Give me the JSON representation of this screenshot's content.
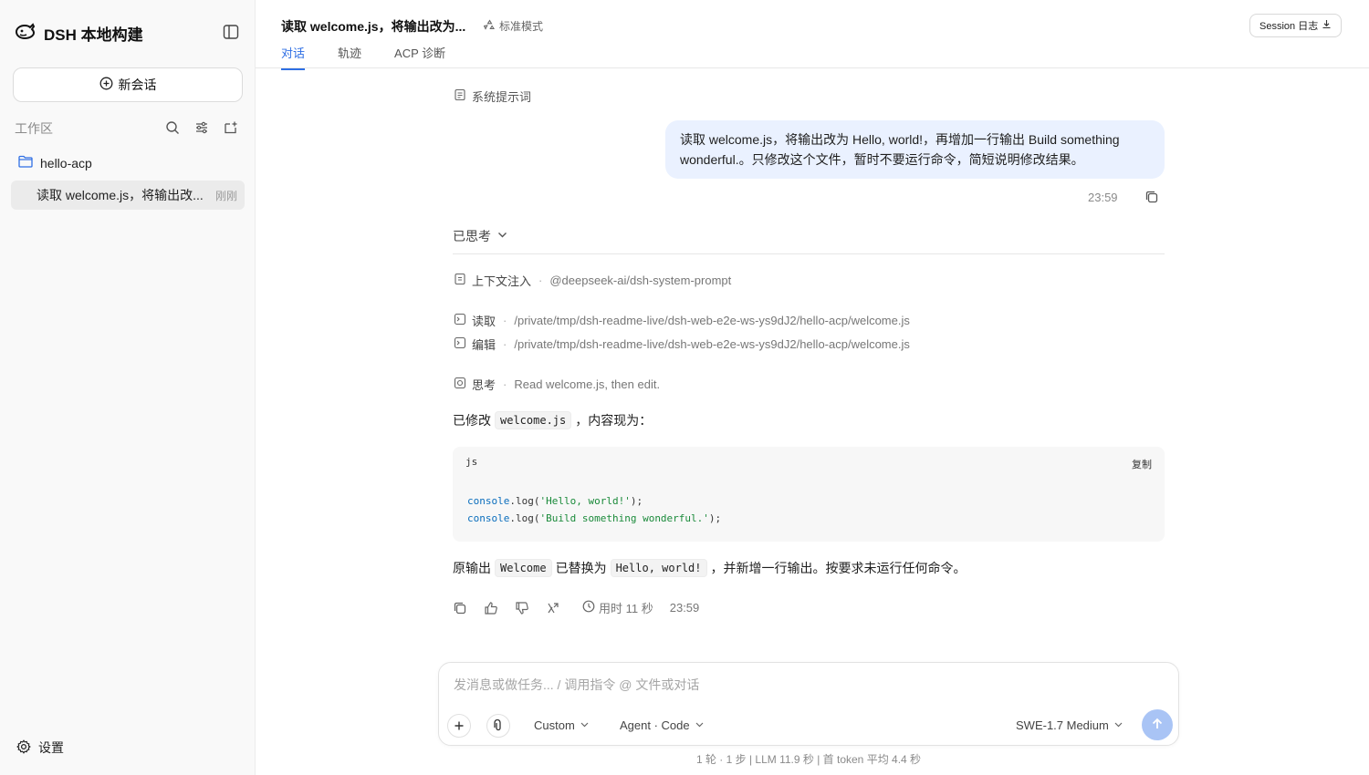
{
  "sidebar": {
    "brand": "DSH 本地构建",
    "new_chat": "新会话",
    "workspace_label": "工作区",
    "folder": "hello-acp",
    "session_title": "读取 welcome.js，将输出改...",
    "session_time": "刚刚",
    "settings": "设置"
  },
  "header": {
    "title": "读取 welcome.js，将输出改为...",
    "mode": "标准模式",
    "tabs": [
      "对话",
      "轨迹",
      "ACP 诊断"
    ],
    "session_log": "Session 日志"
  },
  "chat": {
    "system_prompt": "系统提示词",
    "user_message": "读取 welcome.js，将输出改为 Hello, world!，再增加一行输出 Build something wonderful.。只修改这个文件，暂时不要运行命令，简短说明修改结果。",
    "user_time": "23:59",
    "thought_label": "已思考",
    "steps": [
      {
        "label": "上下文注入",
        "detail": "@deepseek-ai/dsh-system-prompt"
      },
      {
        "label": "读取",
        "detail": "/private/tmp/dsh-readme-live/dsh-web-e2e-ws-ys9dJ2/hello-acp/welcome.js"
      },
      {
        "label": "编辑",
        "detail": "/private/tmp/dsh-readme-live/dsh-web-e2e-ws-ys9dJ2/hello-acp/welcome.js"
      },
      {
        "label": "思考",
        "detail": "Read welcome.js, then edit."
      }
    ],
    "answer_pre": "已修改",
    "answer_file": "welcome.js",
    "answer_post": "，内容现为：",
    "code": {
      "lang": "js",
      "copy": "复制",
      "line1_obj": "console",
      "line1_fn": ".log(",
      "line1_str": "'Hello, world!'",
      "line1_end": ");",
      "line2_obj": "console",
      "line2_fn": ".log(",
      "line2_str": "'Build something wonderful.'",
      "line2_end": ");"
    },
    "summary": {
      "p1": "原输出",
      "c1": "Welcome",
      "p2": "已替换为",
      "c2": "Hello, world!",
      "p3": "，并新增一行输出。按要求未运行任何命令。"
    },
    "elapsed": "用时 11 秒",
    "answer_time": "23:59"
  },
  "composer": {
    "placeholder": "发消息或做任务... / 调用指令 @ 文件或对话",
    "preset": "Custom",
    "agent": "Agent · Code",
    "model": "SWE-1.7 Medium"
  },
  "stats": "1 轮 · 1 步  |  LLM 11.9 秒  |  首 token 平均 4.4 秒",
  "colors": {
    "accent": "#2f6fe4",
    "user_bubble": "#eaf1ff",
    "send_button": "#a9c4f5"
  }
}
